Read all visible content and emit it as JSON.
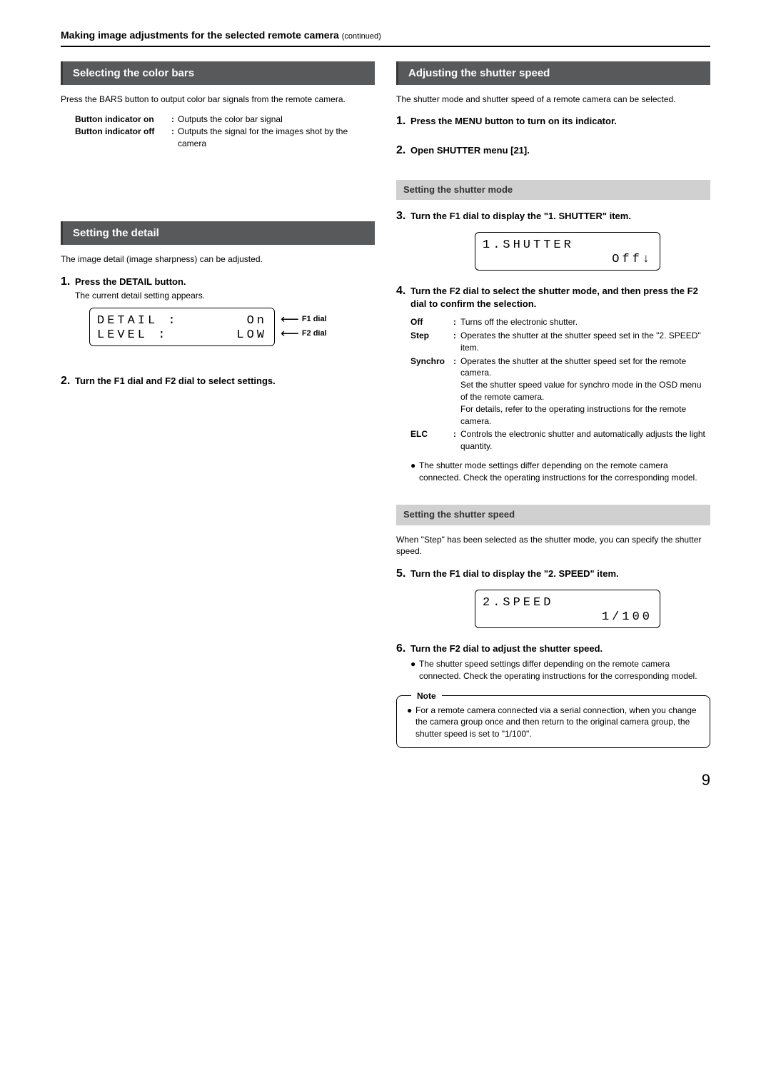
{
  "header": {
    "title": "Making image adjustments for the selected remote camera",
    "continued": "(continued)"
  },
  "left": {
    "section1": {
      "title": "Selecting the color bars",
      "intro": "Press the BARS button to output color bar signals from the remote camera.",
      "ind_on_label": "Button indicator on",
      "ind_on_desc": "Outputs the color bar signal",
      "ind_off_label": "Button indicator off",
      "ind_off_desc": "Outputs the signal for the images shot by the camera"
    },
    "section2": {
      "title": "Setting the detail",
      "intro": "The image detail (image sharpness) can be adjusted.",
      "step1_num": "1.",
      "step1_title": "Press the DETAIL button.",
      "step1_sub": "The current detail setting appears.",
      "lcd_row1_left": "DETAIL :",
      "lcd_row1_right": "On",
      "lcd_row2_left": "LEVEL  :",
      "lcd_row2_right": "LOW",
      "f1_label": "F1 dial",
      "f2_label": "F2 dial",
      "step2_num": "2.",
      "step2_title": "Turn the F1 dial and F2 dial to select settings."
    }
  },
  "right": {
    "section1": {
      "title": "Adjusting the shutter speed",
      "intro": "The shutter mode and shutter speed of a remote camera can be selected.",
      "step1_num": "1.",
      "step1_title": "Press the MENU button to turn on its indicator.",
      "step2_num": "2.",
      "step2_title": "Open SHUTTER menu [21]."
    },
    "sub1": {
      "title": "Setting the shutter mode",
      "step3_num": "3.",
      "step3_title": "Turn the F1 dial to display the \"1. SHUTTER\" item.",
      "lcd_row1": "1.SHUTTER",
      "lcd_row2": "Off↓",
      "step4_num": "4.",
      "step4_title": "Turn the F2 dial to select the shutter mode, and then press the F2 dial to confirm the selection.",
      "off_term": "Off",
      "off_desc": "Turns off the electronic shutter.",
      "step_term": "Step",
      "step_desc": "Operates the shutter at the shutter speed set in the \"2. SPEED\" item.",
      "synchro_term": "Synchro",
      "synchro_desc1": "Operates the shutter at the shutter speed set for the remote camera.",
      "synchro_desc2": "Set the shutter speed value for synchro mode in the OSD menu of the remote camera.",
      "synchro_desc3": "For details, refer to the operating instructions for the remote camera.",
      "elc_term": "ELC",
      "elc_desc": "Controls the electronic shutter and automatically adjusts the light quantity.",
      "bullet": "The shutter mode settings differ depending on the remote camera connected. Check the operating instructions for the corresponding model."
    },
    "sub2": {
      "title": "Setting the shutter speed",
      "intro": "When \"Step\" has been selected as the shutter mode, you can specify the shutter speed.",
      "step5_num": "5.",
      "step5_title": "Turn the F1 dial to display the \"2. SPEED\" item.",
      "lcd_row1": "2.SPEED",
      "lcd_row2": "1/100",
      "step6_num": "6.",
      "step6_title": "Turn the F2 dial to adjust the shutter speed.",
      "bullet": "The shutter speed settings differ depending on the remote camera connected. Check the operating instructions for the corresponding model."
    },
    "note": {
      "title": "Note",
      "text": "For a remote camera connected via a serial connection, when you change the camera group once and then return to the original camera group, the shutter speed is set to \"1/100\"."
    }
  },
  "page_number": "9"
}
